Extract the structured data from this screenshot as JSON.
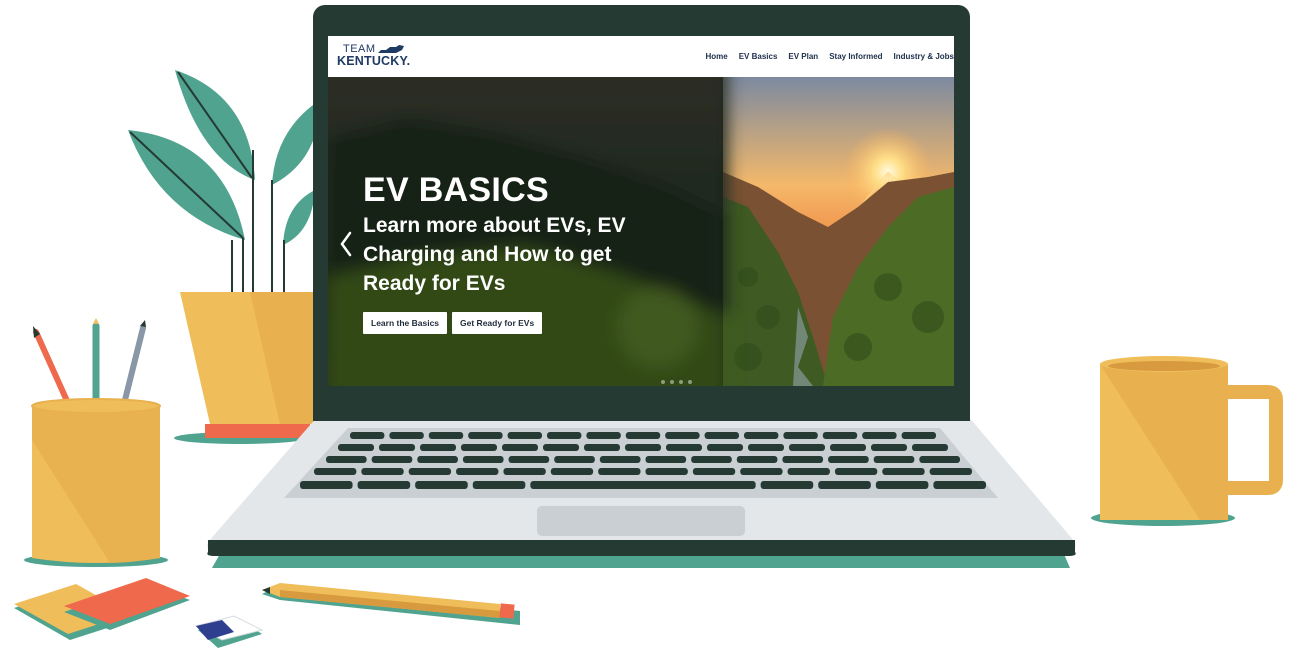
{
  "site": {
    "logo": {
      "team": "TEAM",
      "name": "KENTUCKY."
    },
    "nav": [
      {
        "label": "Home"
      },
      {
        "label": "EV Basics"
      },
      {
        "label": "EV Plan"
      },
      {
        "label": "Stay Informed"
      },
      {
        "label": "Industry & Jobs"
      }
    ]
  },
  "hero": {
    "title": "EV BASICS",
    "subtitle": "Learn more about EVs, EV Charging and How to get Ready for EVs",
    "buttons": [
      {
        "label": "Learn the Basics"
      },
      {
        "label": "Get Ready for EVs"
      }
    ],
    "prev_icon": "chevron-left-icon",
    "dots": 4
  },
  "colors": {
    "laptop_bezel": "#243a33",
    "teal_accent": "#4fa38f",
    "mustard": "#efbd5a",
    "coral": "#ef6a4c",
    "navy_text": "#1f3a63"
  }
}
